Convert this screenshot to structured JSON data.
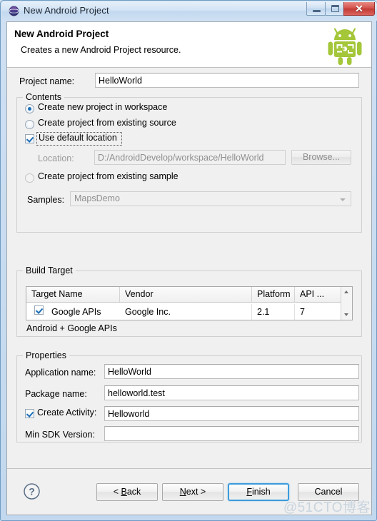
{
  "window": {
    "title": "New Android Project",
    "icon": "android-app-icon",
    "controls": {
      "minimize": "minimize-button",
      "maximize": "maximize-button",
      "close_glyph": "✕"
    }
  },
  "header": {
    "title": "New Android Project",
    "subtitle": "Creates a new Android Project resource.",
    "logo": "android-robot-logo",
    "logo_color": "#A4C639"
  },
  "project_name": {
    "label": "Project name:",
    "value": "HelloWorld",
    "placeholder": ""
  },
  "contents": {
    "legend": "Contents",
    "radio_workspace": {
      "label": "Create new project in workspace",
      "checked": true
    },
    "radio_existing_source": {
      "label": "Create project from existing source",
      "checked": false
    },
    "use_default_location": {
      "label": "Use default location",
      "checked": true,
      "focused": true
    },
    "location": {
      "label": "Location:",
      "value": "D:/AndroidDevelop/workspace/HelloWorld",
      "enabled": false
    },
    "browse_button": {
      "label": "Browse...",
      "enabled": false
    },
    "radio_existing_sample": {
      "label": "Create project from existing sample",
      "checked": false
    },
    "samples": {
      "label": "Samples:",
      "value": "MapsDemo",
      "enabled": false
    }
  },
  "build_target": {
    "legend": "Build Target",
    "columns": [
      "Target Name",
      "Vendor",
      "Platform",
      "API ..."
    ],
    "rows": [
      {
        "checked": true,
        "target_name": "Google APIs",
        "vendor": "Google Inc.",
        "platform": "2.1",
        "api_level": "7"
      }
    ],
    "footnote": "Android + Google APIs",
    "scrollbar": {
      "up": "scroll-up-arrow",
      "down": "scroll-down-arrow"
    }
  },
  "properties": {
    "legend": "Properties",
    "application_name": {
      "label": "Application name:",
      "value": "HelloWorld"
    },
    "package_name": {
      "label": "Package name:",
      "value": "helloworld.test"
    },
    "create_activity": {
      "label": "Create Activity:",
      "checked": true,
      "value": "Helloworld"
    },
    "min_sdk_version": {
      "label": "Min SDK Version:",
      "value": ""
    }
  },
  "buttonbar": {
    "help": "help-icon",
    "back": {
      "pre": "< ",
      "mnemonic": "B",
      "post": "ack"
    },
    "next": {
      "pre": "",
      "mnemonic": "N",
      "post": "ext >"
    },
    "finish": {
      "pre": "",
      "mnemonic": "F",
      "post": "inish",
      "is_default": true
    },
    "cancel": {
      "label": "Cancel"
    }
  },
  "watermark": "@51CTO博客"
}
